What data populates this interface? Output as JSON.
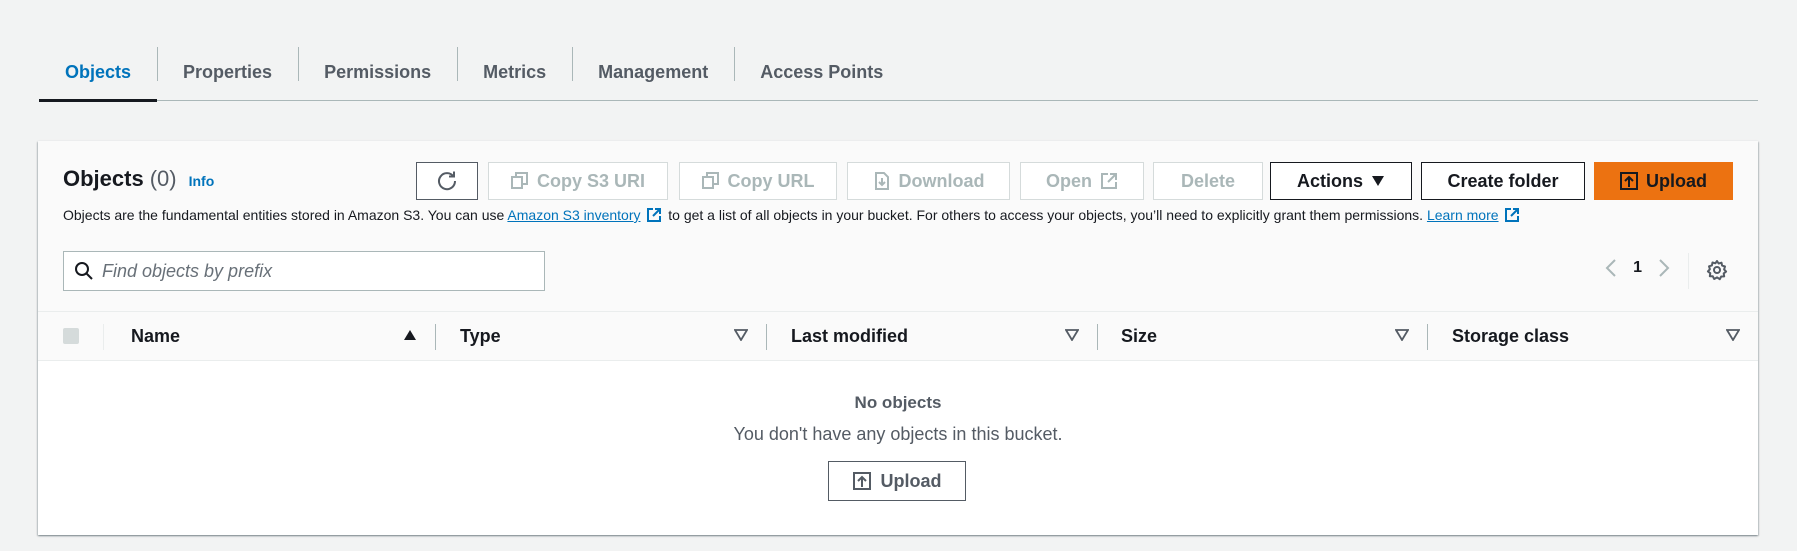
{
  "tabs": [
    {
      "label": "Objects",
      "active": true
    },
    {
      "label": "Properties"
    },
    {
      "label": "Permissions"
    },
    {
      "label": "Metrics"
    },
    {
      "label": "Management"
    },
    {
      "label": "Access Points"
    }
  ],
  "panel": {
    "title": "Objects",
    "count": "(0)",
    "info": "Info",
    "desc_before": "Objects are the fundamental entities stored in Amazon S3. You can use ",
    "inventory_link": "Amazon S3 inventory",
    "desc_middle": " to get a list of all objects in your bucket. For others to access your objects, you’ll need to explicitly grant them permissions. ",
    "learn_more": "Learn more"
  },
  "toolbar": {
    "refresh_icon": "refresh-icon",
    "copy_s3_uri": "Copy S3 URI",
    "copy_url": "Copy URL",
    "download": "Download",
    "open": "Open",
    "delete": "Delete",
    "actions": "Actions",
    "create_folder": "Create folder",
    "upload": "Upload"
  },
  "search": {
    "placeholder": "Find objects by prefix",
    "value": ""
  },
  "pagination": {
    "current_page": "1"
  },
  "table": {
    "columns": [
      "Name",
      "Type",
      "Last modified",
      "Size",
      "Storage class"
    ],
    "empty_title": "No objects",
    "empty_desc": "You don't have any objects in this bucket.",
    "empty_upload": "Upload"
  },
  "colors": {
    "accent": "#0073bb",
    "primary_button": "#ec7211",
    "background": "#f2f3f3"
  }
}
